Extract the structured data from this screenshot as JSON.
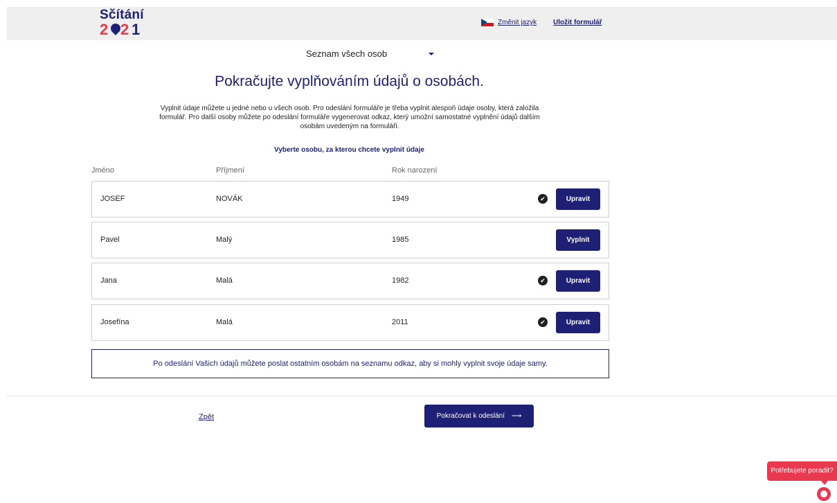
{
  "header": {
    "logo_top": "Sčítání",
    "logo_digits": [
      "2",
      "2",
      "1"
    ],
    "change_language": "Změnit jazyk",
    "save_form": "Uložit formulář"
  },
  "person_select": {
    "value": "Seznam všech osob"
  },
  "page_title": "Pokračujte vyplňováním údajů o osobách.",
  "intro_text": "Vyplnit údaje můžete u jedné nebo u všech osob. Pro odeslání formuláře je třeba vyplnit alespoň údaje osoby, která založila formulář. Pro další osoby můžete po odeslání formuláře vygenerovat odkaz, který umožní samostatné vyplnění údajů dalším osobám uvedeným na formuláři.",
  "subtitle": "Vyberte osobu, za kterou chcete vyplnit údaje",
  "columns": {
    "first": "Jméno",
    "last": "Příjmení",
    "year": "Rok narození"
  },
  "persons": [
    {
      "first": "JOSEF",
      "last": "NOVÁK",
      "year": "1949",
      "done": true,
      "action": "Upravit"
    },
    {
      "first": "Pavel",
      "last": "Malý",
      "year": "1985",
      "done": false,
      "action": "Vyplnit"
    },
    {
      "first": "Jana",
      "last": "Malá",
      "year": "1982",
      "done": true,
      "action": "Upravit"
    },
    {
      "first": "Josefína",
      "last": "Malá",
      "year": "2011",
      "done": true,
      "action": "Upravit"
    }
  ],
  "info_box": "Po odeslání Vašich údajů můžete poslat ostatním osobám na seznamu odkaz, aby si mohly vyplnit svoje údaje samy.",
  "nav": {
    "back": "Zpět",
    "continue": "Pokračovat k odeslání",
    "continue_arrow": "⟶"
  },
  "help": {
    "label": "Potřebujete poradit?"
  },
  "check_glyph": "✔"
}
